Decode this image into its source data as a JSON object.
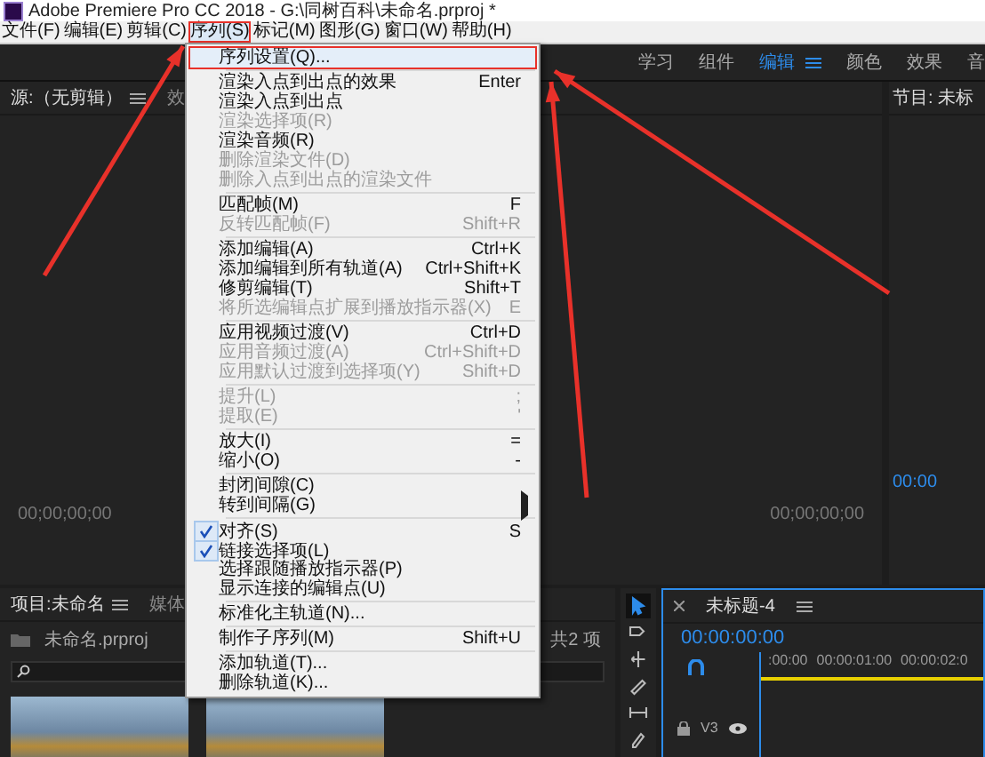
{
  "window": {
    "title": "Adobe Premiere Pro CC 2018 - G:\\同树百科\\未命名.prproj *"
  },
  "menu_bar": [
    {
      "label": "文件(F)",
      "selected": false
    },
    {
      "label": "编辑(E)",
      "selected": false
    },
    {
      "label": "剪辑(C)",
      "selected": false
    },
    {
      "label": "序列(S)",
      "selected": true
    },
    {
      "label": "标记(M)",
      "selected": false
    },
    {
      "label": "图形(G)",
      "selected": false
    },
    {
      "label": "窗口(W)",
      "selected": false
    },
    {
      "label": "帮助(H)",
      "selected": false
    }
  ],
  "open_menu": {
    "items": [
      {
        "kind": "item",
        "label": "序列设置(Q)...",
        "selected": true,
        "disabled": false,
        "checked": false
      },
      {
        "kind": "separator"
      },
      {
        "kind": "item",
        "label": "渲染入点到出点的效果",
        "shortcut": "Enter",
        "selected": false,
        "disabled": false,
        "checked": false
      },
      {
        "kind": "item",
        "label": "渲染入点到出点",
        "selected": false,
        "disabled": false,
        "checked": false
      },
      {
        "kind": "item",
        "label": "渲染选择项(R)",
        "selected": false,
        "disabled": true,
        "checked": false
      },
      {
        "kind": "item",
        "label": "渲染音频(R)",
        "selected": false,
        "disabled": false,
        "checked": false
      },
      {
        "kind": "item",
        "label": "删除渲染文件(D)",
        "selected": false,
        "disabled": true,
        "checked": false
      },
      {
        "kind": "item",
        "label": "删除入点到出点的渲染文件",
        "selected": false,
        "disabled": true,
        "checked": false
      },
      {
        "kind": "separator"
      },
      {
        "kind": "item",
        "label": "匹配帧(M)",
        "shortcut": "F",
        "selected": false,
        "disabled": false,
        "checked": false
      },
      {
        "kind": "item",
        "label": "反转匹配帧(F)",
        "shortcut": "Shift+R",
        "selected": false,
        "disabled": true,
        "checked": false
      },
      {
        "kind": "separator"
      },
      {
        "kind": "item",
        "label": "添加编辑(A)",
        "shortcut": "Ctrl+K",
        "selected": false,
        "disabled": false,
        "checked": false
      },
      {
        "kind": "item",
        "label": "添加编辑到所有轨道(A)",
        "shortcut": "Ctrl+Shift+K",
        "selected": false,
        "disabled": false,
        "checked": false
      },
      {
        "kind": "item",
        "label": "修剪编辑(T)",
        "shortcut": "Shift+T",
        "selected": false,
        "disabled": false,
        "checked": false
      },
      {
        "kind": "item",
        "label": "将所选编辑点扩展到播放指示器(X)",
        "shortcut": "E",
        "selected": false,
        "disabled": true,
        "checked": false
      },
      {
        "kind": "separator"
      },
      {
        "kind": "item",
        "label": "应用视频过渡(V)",
        "shortcut": "Ctrl+D",
        "selected": false,
        "disabled": false,
        "checked": false
      },
      {
        "kind": "item",
        "label": "应用音频过渡(A)",
        "shortcut": "Ctrl+Shift+D",
        "selected": false,
        "disabled": true,
        "checked": false
      },
      {
        "kind": "item",
        "label": "应用默认过渡到选择项(Y)",
        "shortcut": "Shift+D",
        "selected": false,
        "disabled": true,
        "checked": false
      },
      {
        "kind": "separator"
      },
      {
        "kind": "item",
        "label": "提升(L)",
        "shortcut": ";",
        "selected": false,
        "disabled": true,
        "checked": false
      },
      {
        "kind": "item",
        "label": "提取(E)",
        "shortcut": "'",
        "selected": false,
        "disabled": true,
        "checked": false
      },
      {
        "kind": "separator"
      },
      {
        "kind": "item",
        "label": "放大(I)",
        "shortcut": "=",
        "selected": false,
        "disabled": false,
        "checked": false
      },
      {
        "kind": "item",
        "label": "缩小(O)",
        "shortcut": "-",
        "selected": false,
        "disabled": false,
        "checked": false
      },
      {
        "kind": "separator"
      },
      {
        "kind": "item",
        "label": "封闭间隙(C)",
        "selected": false,
        "disabled": false,
        "checked": false
      },
      {
        "kind": "submenu",
        "label": "转到间隔(G)",
        "selected": false,
        "disabled": false,
        "checked": false
      },
      {
        "kind": "separator"
      },
      {
        "kind": "item",
        "label": "对齐(S)",
        "shortcut": "S",
        "selected": false,
        "disabled": false,
        "checked": true
      },
      {
        "kind": "item",
        "label": "链接选择项(L)",
        "selected": false,
        "disabled": false,
        "checked": true
      },
      {
        "kind": "item",
        "label": "选择跟随播放指示器(P)",
        "selected": false,
        "disabled": false,
        "checked": false
      },
      {
        "kind": "item",
        "label": "显示连接的编辑点(U)",
        "selected": false,
        "disabled": false,
        "checked": false
      },
      {
        "kind": "separator"
      },
      {
        "kind": "item",
        "label": "标准化主轨道(N)...",
        "selected": false,
        "disabled": false,
        "checked": false
      },
      {
        "kind": "separator"
      },
      {
        "kind": "item",
        "label": "制作子序列(M)",
        "shortcut": "Shift+U",
        "selected": false,
        "disabled": false,
        "checked": false
      },
      {
        "kind": "separator"
      },
      {
        "kind": "item",
        "label": "添加轨道(T)...",
        "selected": false,
        "disabled": false,
        "checked": false
      },
      {
        "kind": "item",
        "label": "删除轨道(K)...",
        "selected": false,
        "disabled": false,
        "checked": false
      }
    ]
  },
  "workspaces": [
    {
      "label": "学习",
      "selected": false
    },
    {
      "label": "组件",
      "selected": false
    },
    {
      "label": "编辑",
      "selected": true
    },
    {
      "label": "颜色",
      "selected": false
    },
    {
      "label": "效果",
      "selected": false
    },
    {
      "label": "音",
      "selected": false
    }
  ],
  "source_panel": {
    "tabs": [
      {
        "label": "源:（无剪辑）",
        "selected": true
      },
      {
        "label": "效",
        "selected": false
      }
    ],
    "timecode_left": "00;00;00;00",
    "timecode_right": "00;00;00;00"
  },
  "program_panel": {
    "title": "节目: 未标",
    "timecode": "00:00"
  },
  "project_panel": {
    "tabs": [
      {
        "label": "项目:未命名",
        "selected": true
      },
      {
        "label": "媒体",
        "selected": false
      }
    ],
    "file": "未命名.prproj",
    "item_count": "共2 项"
  },
  "tools": [
    {
      "kind": "select",
      "selected": true
    },
    {
      "kind": "track",
      "selected": false
    },
    {
      "kind": "ripple",
      "selected": false
    },
    {
      "kind": "razor",
      "selected": false
    },
    {
      "kind": "slip",
      "selected": false
    },
    {
      "kind": "pen",
      "selected": false
    }
  ],
  "timeline": {
    "title": "未标题-4",
    "timecode": "00:00:00:00",
    "ruler": [
      ":00:00",
      "00:00:01:00",
      "00:00:02:0"
    ],
    "track": "V3"
  }
}
